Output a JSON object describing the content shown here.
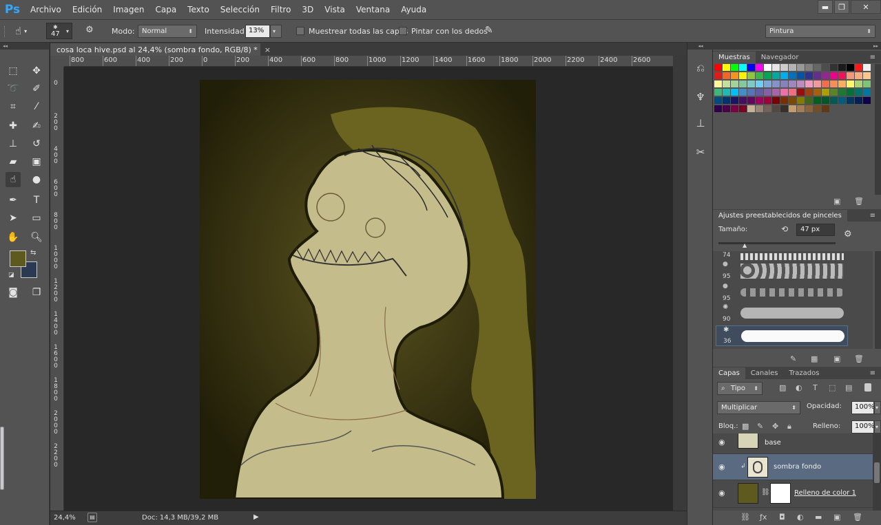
{
  "app": {
    "logo": "Ps"
  },
  "menu": [
    "Archivo",
    "Edición",
    "Imagen",
    "Capa",
    "Texto",
    "Selección",
    "Filtro",
    "3D",
    "Vista",
    "Ventana",
    "Ayuda"
  ],
  "window_controls": {
    "minimize": "▬",
    "restore": "❐",
    "close": "✕"
  },
  "options": {
    "brush_size": "47",
    "mode_label": "Modo:",
    "mode_value": "Normal",
    "intensity_label": "Intensidad:",
    "intensity_value": "13%",
    "sample_all_label": "Muestrear todas las capas",
    "finger_label": "Pintar con los dedos",
    "workspace": "Pintura"
  },
  "document": {
    "tab_title": "cosa loca hive.psd al 24,4% (sombra fondo, RGB/8) *",
    "close_glyph": "×",
    "zoom": "24,4%",
    "doc_info": "Doc: 14,3 MB/39,2 MB"
  },
  "ruler": {
    "h_labels": [
      "800",
      "600",
      "400",
      "200",
      "0",
      "200",
      "400",
      "600",
      "800",
      "1000",
      "1200",
      "1400",
      "1600",
      "1800",
      "2000",
      "2200",
      "2400",
      "2600"
    ],
    "v_labels": [
      "0",
      "200",
      "400",
      "600",
      "800",
      "1000",
      "1200",
      "1400",
      "1600",
      "1800",
      "2000",
      "2200"
    ]
  },
  "swatches_panel": {
    "tabs": [
      "Muestras",
      "Navegador"
    ]
  },
  "swatch_colors": [
    [
      "#ff0000",
      "#ffff00",
      "#00ff00",
      "#00ffff",
      "#0000ff",
      "#ff00ff",
      "#ffffff",
      "#e6e6e6",
      "#cccccc",
      "#b3b3b3",
      "#999999",
      "#808080",
      "#666666",
      "#4d4d4d",
      "#333333",
      "#1a1a1a",
      "#000000",
      "#ff1a1a",
      "#f0f0f0"
    ],
    [
      "#e11a1a",
      "#f26522",
      "#f7941d",
      "#fff200",
      "#8dc63f",
      "#39b54a",
      "#00a651",
      "#00a99d",
      "#00aeef",
      "#0072bc",
      "#0054a6",
      "#2e3192",
      "#662d91",
      "#92278f",
      "#ec008c",
      "#ed145b",
      "#f69679",
      "#f9ad81",
      "#fdc68a"
    ],
    [
      "#fff799",
      "#c4df9b",
      "#a3d39c",
      "#82ca9d",
      "#7accc8",
      "#6dcff6",
      "#7da7d9",
      "#8393ca",
      "#8781bd",
      "#a186be",
      "#bd8cbf",
      "#f49ac1",
      "#f5989d",
      "#f26c4f",
      "#f68e56",
      "#fbaf5d",
      "#fff568",
      "#acd373",
      "#7cc576"
    ],
    [
      "#3cb878",
      "#1cbbb4",
      "#00bff3",
      "#448ccb",
      "#5574b9",
      "#605ca8",
      "#8560a8",
      "#a864a8",
      "#f06eaa",
      "#f26d7d",
      "#9e0b0f",
      "#a0410d",
      "#a36209",
      "#aba000",
      "#598527",
      "#197b30",
      "#007236",
      "#00746b",
      "#0076a3"
    ],
    [
      "#004b80",
      "#003471",
      "#1b1464",
      "#440e62",
      "#630460",
      "#9e005d",
      "#9e0039",
      "#790000",
      "#7b2e00",
      "#7d4900",
      "#827b00",
      "#406618",
      "#005e20",
      "#005826",
      "#005952",
      "#005b7f",
      "#003663",
      "#002157",
      "#0d004c"
    ],
    [
      "#32004b",
      "#4b0049",
      "#7b0046",
      "#7a0026",
      "#c7b299",
      "#998675",
      "#736357",
      "#534741",
      "#37302a",
      "#c69c6d",
      "#a67c52",
      "#8c6239",
      "#754c24",
      "#603913"
    ]
  ],
  "brushes_panel": {
    "title": "Ajustes preestablecidos de pinceles",
    "size_label": "Tamaño:",
    "size_value": "47 px",
    "brushes": [
      {
        "size": "74"
      },
      {
        "size": "95"
      },
      {
        "size": "95"
      },
      {
        "size": "90"
      },
      {
        "size": "36"
      }
    ]
  },
  "layers_panel": {
    "tabs": [
      "Capas",
      "Canales",
      "Trazados"
    ],
    "filter": "Tipo",
    "blend_mode": "Multiplicar",
    "opacity_label": "Opacidad:",
    "opacity_value": "100%",
    "lock_label": "Bloq.:",
    "fill_label": "Relleno:",
    "fill_value": "100%",
    "layers": [
      {
        "name": "base"
      },
      {
        "name": "sombra fondo"
      },
      {
        "name": "Relleno de color 1"
      }
    ]
  },
  "colors": {
    "foreground": "#5e5a1f",
    "background": "#2b3a52",
    "canvas_bg": "#2a2708",
    "shadow_olive": "#6b6420",
    "skin": "#c4bc8a",
    "accent_blue": "#31a8ff"
  }
}
